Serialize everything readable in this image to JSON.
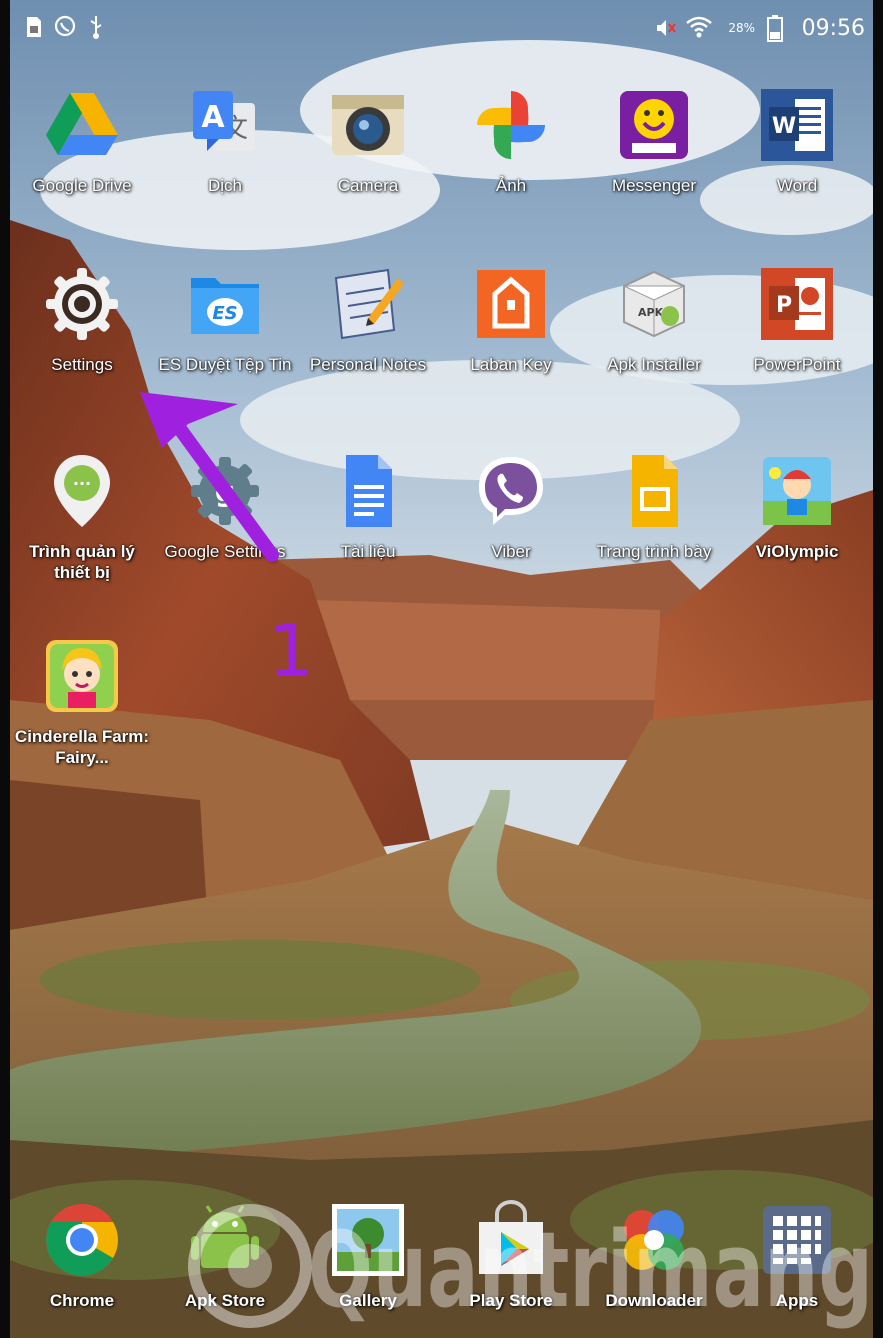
{
  "status_bar": {
    "time": "09:56",
    "battery_percent": "28%",
    "icons": [
      "sim-icon",
      "whatsapp-icon",
      "usb-icon",
      "mute-icon",
      "wifi-icon",
      "battery-icon"
    ]
  },
  "home_apps": [
    {
      "label": "Google Drive",
      "icon": "google-drive-icon"
    },
    {
      "label": "Dịch",
      "icon": "translate-icon"
    },
    {
      "label": "Camera",
      "icon": "camera-icon"
    },
    {
      "label": "Ảnh",
      "icon": "photos-icon"
    },
    {
      "label": "Messenger",
      "icon": "yahoo-messenger-icon"
    },
    {
      "label": "Word",
      "icon": "word-icon"
    },
    {
      "label": "Settings",
      "icon": "settings-gear-icon"
    },
    {
      "label": "ES Duyệt Tệp Tin",
      "icon": "es-file-explorer-icon"
    },
    {
      "label": "Personal Notes",
      "icon": "personal-notes-icon"
    },
    {
      "label": "Laban Key",
      "icon": "laban-key-icon"
    },
    {
      "label": "Apk Installer",
      "icon": "apk-installer-icon"
    },
    {
      "label": "PowerPoint",
      "icon": "powerpoint-icon"
    },
    {
      "label": "Trình quản lý thiết bị",
      "icon": "device-manager-icon"
    },
    {
      "label": "Google Settings",
      "icon": "google-settings-icon"
    },
    {
      "label": "Tài liệu",
      "icon": "google-docs-icon"
    },
    {
      "label": "Viber",
      "icon": "viber-icon"
    },
    {
      "label": "Trang trình bày",
      "icon": "google-slides-icon"
    },
    {
      "label": "ViOlympic",
      "icon": "violympic-icon"
    },
    {
      "label": "Cinderella Farm: Fairy...",
      "icon": "cinderella-farm-icon"
    }
  ],
  "dock": [
    {
      "label": "Chrome",
      "icon": "chrome-icon"
    },
    {
      "label": "Apk Store",
      "icon": "apk-store-icon"
    },
    {
      "label": "Gallery",
      "icon": "gallery-icon"
    },
    {
      "label": "Play Store",
      "icon": "play-store-icon"
    },
    {
      "label": "Downloader",
      "icon": "downloader-icon"
    },
    {
      "label": "Apps",
      "icon": "apps-grid-icon"
    }
  ],
  "annotation": {
    "step_number": "1",
    "color": "#a020e0"
  },
  "watermark": "Quantrimang"
}
